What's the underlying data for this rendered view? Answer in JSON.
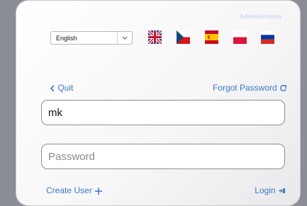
{
  "header": {
    "admin_label": "Administration"
  },
  "language": {
    "selected": "English",
    "flags": [
      "uk-flag",
      "czech-flag",
      "spain-flag",
      "poland-flag",
      "russia-flag"
    ]
  },
  "nav": {
    "quit_label": "Quit",
    "forgot_label": "Forgot Password"
  },
  "form": {
    "username_value": "mk",
    "password_placeholder": "Password"
  },
  "footer": {
    "create_label": "Create User",
    "login_label": "Login"
  },
  "colors": {
    "accent": "#3a78c9",
    "admin_text": "#c9d7f0"
  }
}
